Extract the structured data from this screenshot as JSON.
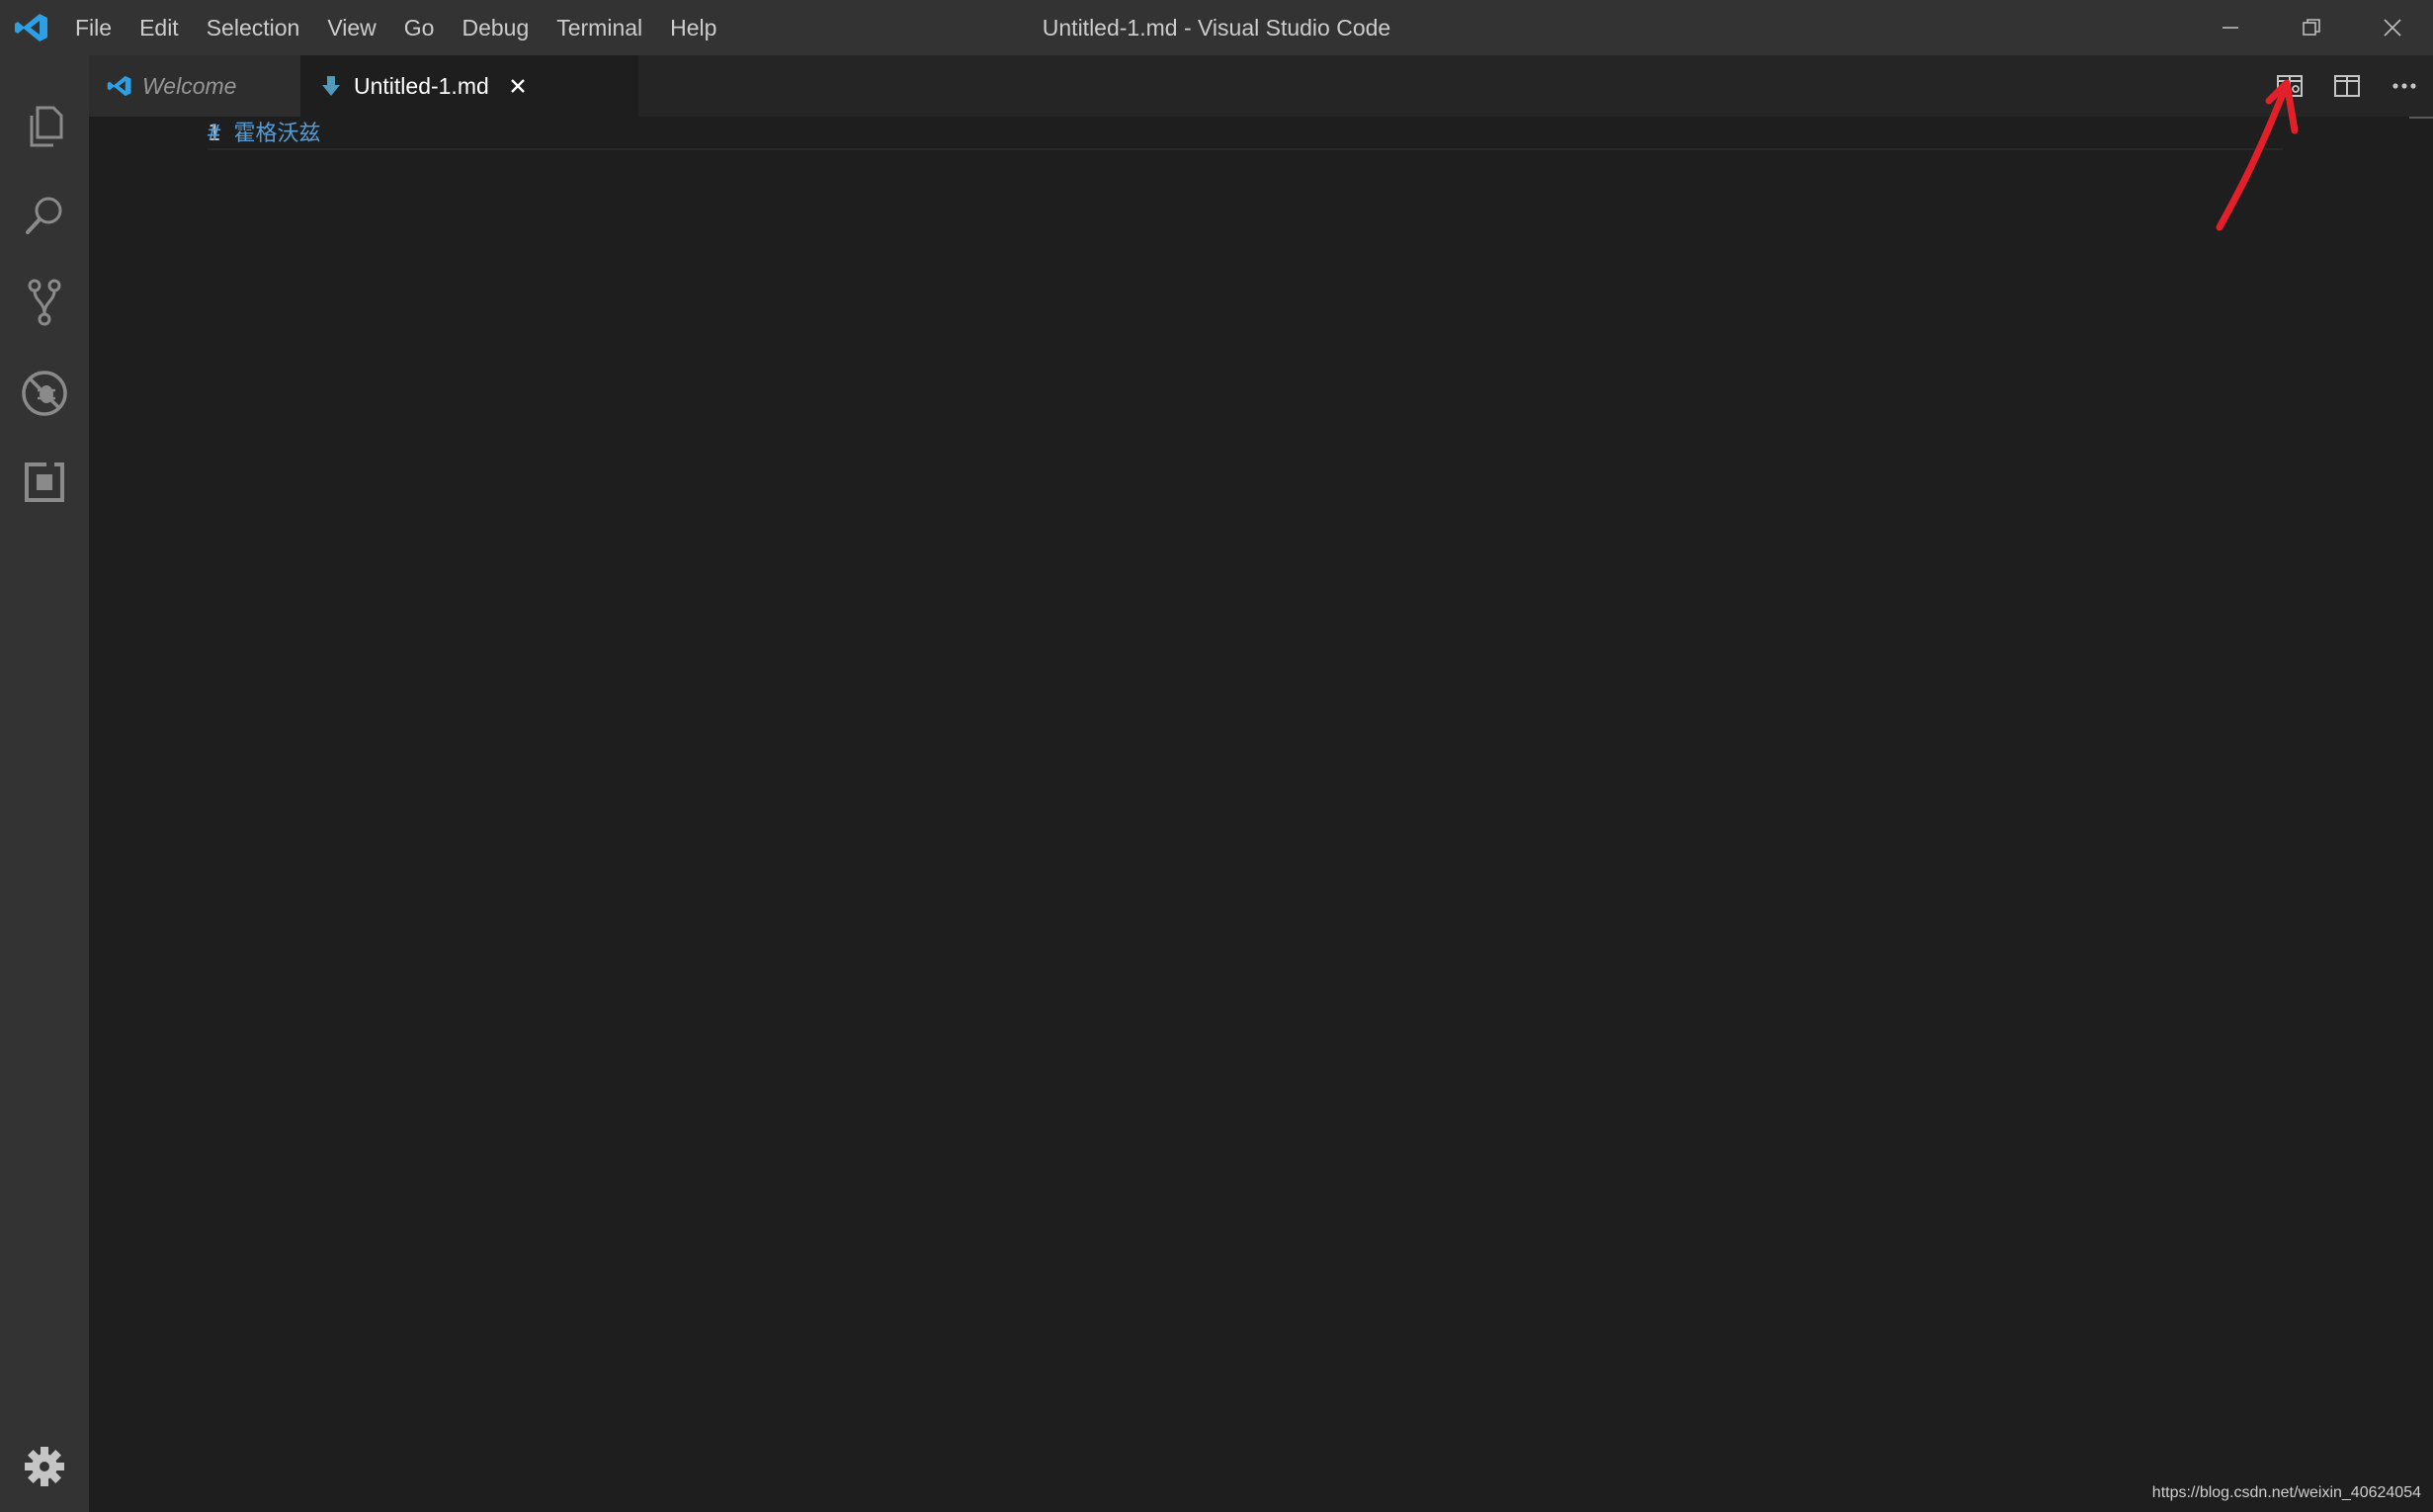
{
  "window": {
    "title": "Untitled-1.md - Visual Studio Code"
  },
  "menu": [
    "File",
    "Edit",
    "Selection",
    "View",
    "Go",
    "Debug",
    "Terminal",
    "Help"
  ],
  "activity_bar": [
    "explorer-icon",
    "search-icon",
    "source-control-icon",
    "debug-icon",
    "extensions-icon",
    "settings-gear-icon"
  ],
  "tabs": [
    {
      "label": "Welcome",
      "icon": "vscode-logo-icon",
      "active": false
    },
    {
      "label": "Untitled-1.md",
      "icon": "markdown-icon",
      "active": true
    }
  ],
  "editor_actions": [
    "open-preview-to-side-icon",
    "split-editor-icon",
    "more-actions-icon"
  ],
  "editor": {
    "lines": [
      {
        "number": "1",
        "text": "# 霍格沃兹"
      }
    ]
  },
  "watermark": "https://blog.csdn.net/weixin_40624054",
  "colors": {
    "accent": "#0078d4",
    "heading": "#569cd6",
    "annotation": "#e3202a"
  }
}
